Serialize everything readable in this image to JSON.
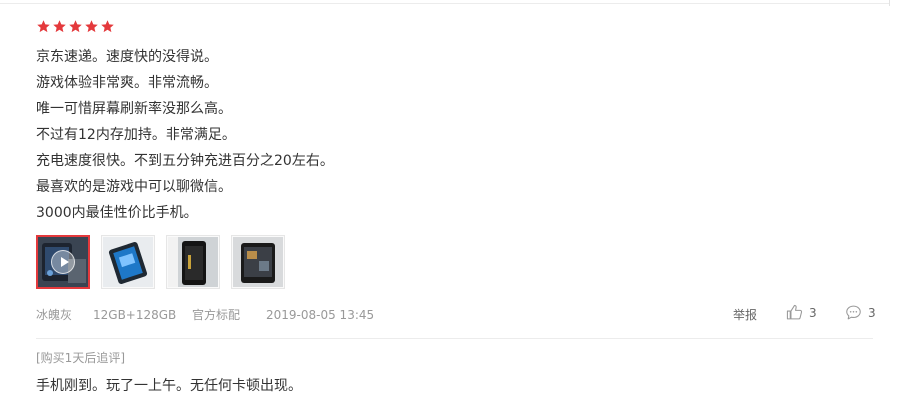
{
  "rating": {
    "stars": 5,
    "max": 5,
    "color": "#e4393c"
  },
  "review": {
    "lines": [
      "京东速递。速度快的没得说。",
      "游戏体验非常爽。非常流畅。",
      "唯一可惜屏幕刷新率没那么高。",
      "不过有12内存加持。非常满足。",
      "充电速度很快。不到五分钟充进百分之20左右。",
      "最喜欢的是游戏中可以聊微信。",
      "3000内最佳性价比手机。"
    ]
  },
  "media": {
    "thumbnails": [
      {
        "kind": "video",
        "icon": "play-icon",
        "active": true
      },
      {
        "kind": "image"
      },
      {
        "kind": "image"
      },
      {
        "kind": "image"
      }
    ]
  },
  "meta": {
    "color": "冰魄灰",
    "spec": "12GB+128GB",
    "package": "官方标配",
    "date": "2019-08-05 13:45"
  },
  "actions": {
    "report": "举报",
    "like_count": "3",
    "comment_count": "3",
    "like_icon": "thumbs-up-icon",
    "comment_icon": "comment-bubble-icon"
  },
  "followup": {
    "label": "[购买1天后追评]",
    "text": "手机刚到。玩了一上午。无任何卡顿出现。"
  }
}
